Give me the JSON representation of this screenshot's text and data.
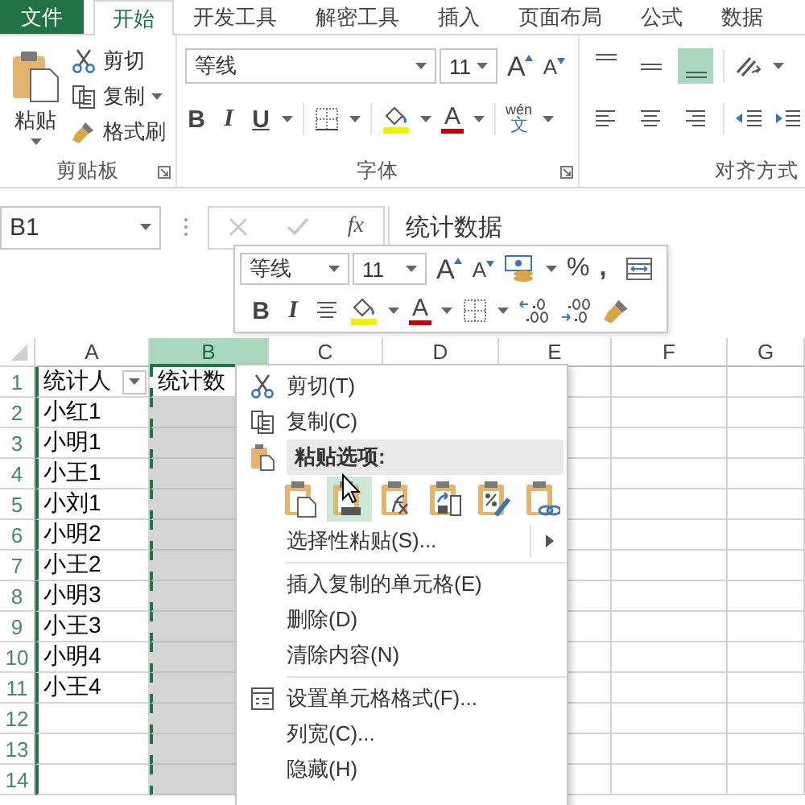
{
  "tabs": [
    {
      "label": "文件",
      "kind": "file",
      "selected": false
    },
    {
      "label": "开始",
      "kind": "tab",
      "selected": true
    },
    {
      "label": "开发工具",
      "kind": "tab",
      "selected": false
    },
    {
      "label": "解密工具",
      "kind": "tab",
      "selected": false
    },
    {
      "label": "插入",
      "kind": "tab",
      "selected": false
    },
    {
      "label": "页面布局",
      "kind": "tab",
      "selected": false
    },
    {
      "label": "公式",
      "kind": "tab",
      "selected": false
    },
    {
      "label": "数据",
      "kind": "tab",
      "selected": false
    }
  ],
  "clipboard": {
    "paste": "粘贴",
    "cut": "剪切",
    "copy": "复制",
    "format_painter": "格式刷",
    "label": "剪贴板"
  },
  "font": {
    "name": "等线",
    "size": "11",
    "grow": "A",
    "shrink": "A",
    "bold": "B",
    "italic": "I",
    "underline": "U",
    "font_color": "A",
    "phonetic": "wén",
    "phonetic_char": "文",
    "label": "字体"
  },
  "alignment": {
    "vertical": [
      {
        "selected": false
      },
      {
        "selected": false
      },
      {
        "selected": true
      }
    ],
    "horizontal": [
      {
        "selected": false
      },
      {
        "selected": false
      },
      {
        "selected": false
      }
    ],
    "label": "对齐方式"
  },
  "formula_bar": {
    "name_box": "B1",
    "function": "fx",
    "value": "统计数据"
  },
  "mini_toolbar": {
    "font_name": "等线",
    "font_size": "11",
    "grow": "A",
    "shrink": "A",
    "percent": "%",
    "comma": ",",
    "bold": "B",
    "italic": "I",
    "font_color": "A"
  },
  "columns": [
    {
      "label": "A",
      "selected": false,
      "copied": false
    },
    {
      "label": "B",
      "selected": true,
      "copied": true
    },
    {
      "label": "C",
      "selected": false,
      "copied": false
    },
    {
      "label": "D",
      "selected": false,
      "copied": false
    },
    {
      "label": "E",
      "selected": false,
      "copied": false
    },
    {
      "label": "F",
      "selected": false,
      "copied": false
    },
    {
      "label": "G",
      "selected": false,
      "copied": false
    }
  ],
  "rows": [
    {
      "number": "1",
      "cells": [
        "统计人",
        "统计数"
      ],
      "filter": true
    },
    {
      "number": "2",
      "cells": [
        "小红1"
      ]
    },
    {
      "number": "3",
      "cells": [
        "小明1"
      ]
    },
    {
      "number": "4",
      "cells": [
        "小王1"
      ]
    },
    {
      "number": "5",
      "cells": [
        "小刘1"
      ]
    },
    {
      "number": "6",
      "cells": [
        "小明2"
      ]
    },
    {
      "number": "7",
      "cells": [
        "小王2"
      ]
    },
    {
      "number": "8",
      "cells": [
        "小明3"
      ]
    },
    {
      "number": "9",
      "cells": [
        "小王3"
      ]
    },
    {
      "number": "10",
      "cells": [
        "小明4"
      ]
    },
    {
      "number": "11",
      "cells": [
        "小王4"
      ]
    },
    {
      "number": "12"
    },
    {
      "number": "13"
    },
    {
      "number": "14"
    }
  ],
  "context_menu": [
    {
      "kind": "cut",
      "label": "剪切(T)"
    },
    {
      "kind": "copy",
      "label": "复制(C)"
    },
    {
      "kind": "paste_header",
      "label": "粘贴选项:"
    },
    {
      "kind": "paste_options",
      "options": [
        {
          "selected": false
        },
        {
          "selected": true
        },
        {
          "selected": false
        },
        {
          "selected": false
        },
        {
          "selected": false
        },
        {
          "selected": false
        }
      ]
    },
    {
      "kind": "submenu",
      "label": "选择性粘贴(S)..."
    },
    {
      "kind": "separator"
    },
    {
      "kind": "plain",
      "label": "插入复制的单元格(E)"
    },
    {
      "kind": "plain",
      "label": "删除(D)"
    },
    {
      "kind": "plain",
      "label": "清除内容(N)"
    },
    {
      "kind": "separator"
    },
    {
      "kind": "format",
      "label": "设置单元格格式(F)..."
    },
    {
      "kind": "plain",
      "label": "列宽(C)..."
    },
    {
      "kind": "plain",
      "label": "隐藏(H)"
    }
  ]
}
